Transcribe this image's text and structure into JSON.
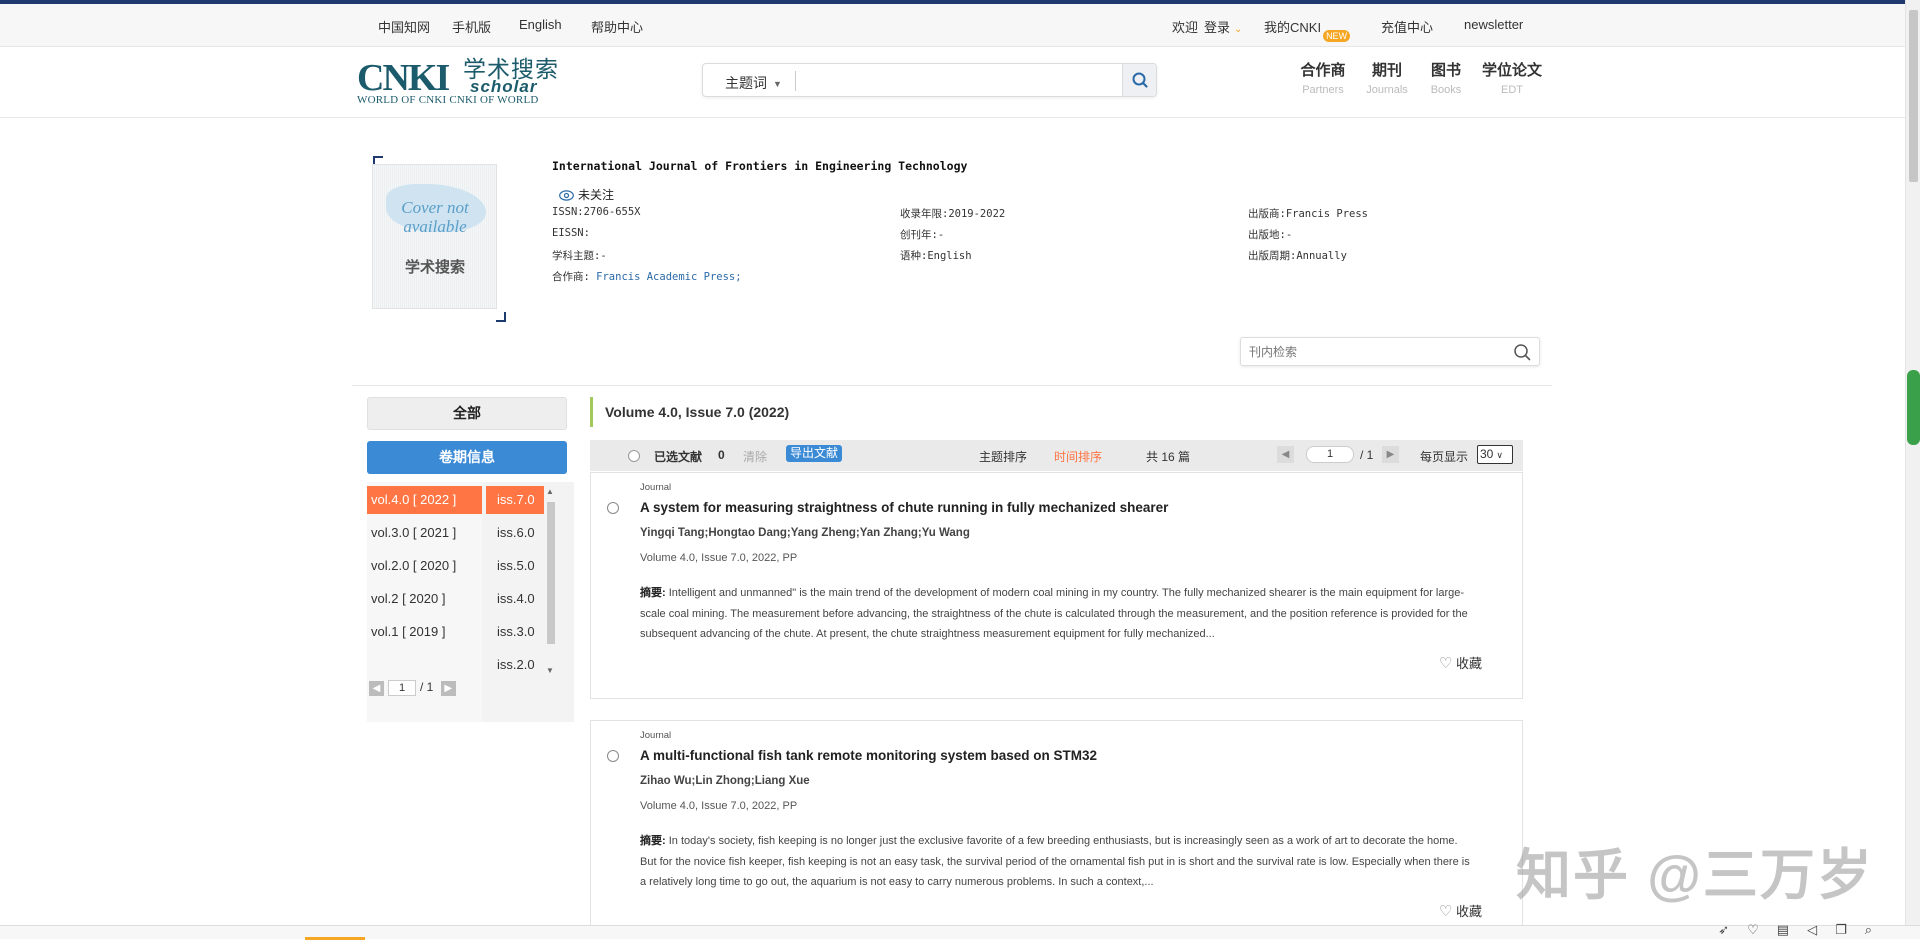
{
  "topbar": {
    "links": [
      "中国知网",
      "手机版",
      "English",
      "帮助中心"
    ],
    "welcome": "欢迎",
    "login": "登录",
    "my_cnki": "我的CNKI",
    "new_badge": "NEW",
    "recharge": "充值中心",
    "newsletter": "newsletter"
  },
  "logo": {
    "main": "CNKI",
    "cn": "学术搜索",
    "scholar": "scholar",
    "sub": "WORLD OF CNKI CNKI OF WORLD"
  },
  "search": {
    "type": "主题词",
    "value": ""
  },
  "nav": [
    {
      "cn": "合作商",
      "en": "Partners"
    },
    {
      "cn": "期刊",
      "en": "Journals"
    },
    {
      "cn": "图书",
      "en": "Books"
    },
    {
      "cn": "学位论文",
      "en": "EDT"
    }
  ],
  "journal": {
    "cover_text": "Cover not available",
    "cover_logo": "学术搜索",
    "title": "International Journal of Frontiers in Engineering Technology",
    "follow": "未关注",
    "issn": "ISSN:2706-655X",
    "eissn": "EISSN:",
    "subject": "学科主题:-",
    "partner_label": "合作商:",
    "partner_value": "Francis Academic Press;",
    "years": "收录年限:2019-2022",
    "founded": "创刊年:-",
    "language": "语种:English",
    "publisher": "出版商:Francis Press",
    "place": "出版地:-",
    "cycle": "出版周期:Annually"
  },
  "inner_search": {
    "placeholder": "刊内检索"
  },
  "sidebar": {
    "all": "全部",
    "info": "卷期信息",
    "volumes": [
      "vol.4.0 [ 2022 ]",
      "vol.3.0 [ 2021 ]",
      "vol.2.0 [ 2020 ]",
      "vol.2 [ 2020 ]",
      "vol.1 [ 2019 ]"
    ],
    "issues": [
      "iss.7.0",
      "iss.6.0",
      "iss.5.0",
      "iss.4.0",
      "iss.3.0",
      "iss.2.0"
    ],
    "page": "1",
    "total": "/ 1"
  },
  "results": {
    "heading": "Volume 4.0, Issue 7.0 (2022)",
    "selected_label": "已选文献",
    "selected_count": "0",
    "clear": "清除",
    "export": "导出文献",
    "sort_topic": "主题排序",
    "sort_time": "时间排序",
    "total": "共 16 篇",
    "page": "1",
    "page_total": "/ 1",
    "per_page_label": "每页显示",
    "per_page": "30",
    "accent": "#ff7543"
  },
  "articles": [
    {
      "type": "Journal",
      "title": "A system for measuring straightness of chute running in fully mechanized shearer",
      "authors": "Yingqi Tang;Hongtao Dang;Yang Zheng;Yan Zhang;Yu Wang",
      "source": "Volume 4.0, Issue 7.0, 2022, PP",
      "abs_label": "摘要:",
      "abstract": "Intelligent and unmanned\" is the main trend of the development of modern coal mining in my country. The fully mechanized shearer is the main equipment for large-scale coal mining. The measurement before advancing, the straightness of the chute is calculated through the measurement, and the position reference is provided for the subsequent advancing of the chute. At present, the chute straightness measurement equipment for fully mechanized...",
      "fav": "收藏"
    },
    {
      "type": "Journal",
      "title": "A multi-functional fish tank remote monitoring system based on STM32",
      "authors": "Zihao Wu;Lin Zhong;Liang Xue",
      "source": "Volume 4.0, Issue 7.0, 2022, PP",
      "abs_label": "摘要:",
      "abstract": "In today's society, fish keeping is no longer just the exclusive favorite of a few breeding enthusiasts, but is increasingly seen as a work of art to decorate the home. But for the novice fish keeper, fish keeping is not an easy task, the survival period of the ornamental fish put in is short and the survival rate is low. Especially when there is a relatively long time to go out, the aquarium is not easy to carry numerous problems. In such a context,...",
      "fav": "收藏"
    }
  ],
  "watermark": "知乎 @三万岁"
}
